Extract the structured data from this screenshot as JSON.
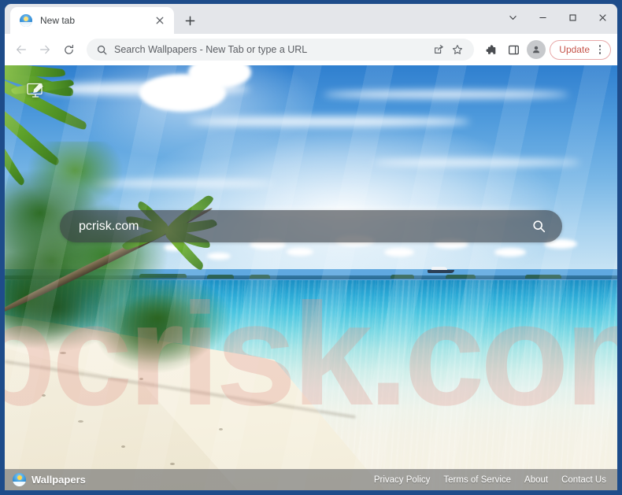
{
  "window": {
    "frame_color": "#1e4c8a",
    "controls": {
      "tab_search_label": "Tab search",
      "minimize_label": "Minimize",
      "maximize_label": "Maximize",
      "close_label": "Close"
    }
  },
  "tabstrip": {
    "tabs": [
      {
        "title": "New tab",
        "favicon": "wallpapers-sun-icon",
        "active": true,
        "close_label": "Close tab"
      }
    ],
    "new_tab_label": "New tab"
  },
  "toolbar": {
    "back_label": "Back",
    "forward_label": "Forward",
    "reload_label": "Reload",
    "omnibox": {
      "placeholder": "Search Wallpapers - New Tab or type a URL",
      "value": "",
      "leading_icon": "search-icon",
      "trailing_icons": [
        "share-icon",
        "bookmark-star-icon"
      ]
    },
    "actions": [
      {
        "name": "extensions-puzzle-icon",
        "label": "Extensions"
      },
      {
        "name": "side-panel-icon",
        "label": "Side panel"
      }
    ],
    "profile_label": "Profile",
    "update_button": {
      "label": "Update",
      "text_color": "#c5544a",
      "border_color": "#e8a9a9",
      "menu_label": "Customize and control Google Chrome"
    }
  },
  "page": {
    "customize_label": "Customize this page",
    "watermark_text": "pcrisk.com",
    "watermark_color": "#e2968c",
    "search": {
      "value": "pcrisk.com",
      "search_icon": "magnifier-icon"
    },
    "footer": {
      "brand": "Wallpapers",
      "links": [
        {
          "label": "Privacy Policy"
        },
        {
          "label": "Terms of Service"
        },
        {
          "label": "About"
        },
        {
          "label": "Contact Us"
        }
      ]
    }
  }
}
